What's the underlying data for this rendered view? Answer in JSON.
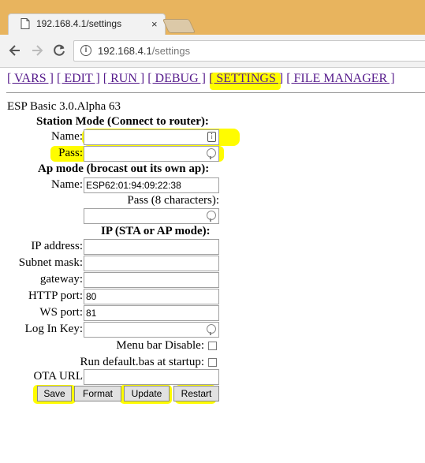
{
  "browser": {
    "tab_title": "192.168.4.1/settings",
    "tab_close": "×",
    "url_host": "192.168.4.1",
    "url_path": "/settings",
    "icons": [
      "page-icon",
      "close-icon",
      "back-arrow-icon",
      "forward-arrow-icon",
      "reload-icon",
      "info-icon"
    ]
  },
  "nav_menu": [
    {
      "label": "[ VARS ]"
    },
    {
      "label": "[ EDIT ]"
    },
    {
      "label": "[ RUN ]"
    },
    {
      "label": "[ DEBUG ]"
    },
    {
      "label": "[ SETTINGS ]"
    },
    {
      "label": "[ FILE MANAGER ]"
    }
  ],
  "version": "ESP Basic 3.0.Alpha 63",
  "station": {
    "heading": "Station Mode (Connect to router):",
    "name_label": "Name:",
    "name_value": "",
    "pass_label": "Pass:",
    "pass_value": ""
  },
  "ap": {
    "heading": "Ap mode (brocast out its own ap):",
    "name_label": "Name:",
    "name_value": "ESP62:01:94:09:22:38",
    "pass_label": "Pass (8 characters):",
    "pass_value": ""
  },
  "ip": {
    "heading": "IP (STA or AP mode):",
    "ip_label": "IP address:",
    "ip_value": "",
    "subnet_label": "Subnet mask:",
    "subnet_value": "",
    "gateway_label": "gateway:",
    "gateway_value": "",
    "http_port_label": "HTTP port:",
    "http_port_value": "80",
    "ws_port_label": "WS port:",
    "ws_port_value": "81",
    "login_key_label": "Log In Key:",
    "login_key_value": ""
  },
  "options": {
    "menu_bar_label": "Menu bar Disable:",
    "menu_bar_checked": false,
    "run_default_label": "Run default.bas at startup:",
    "run_default_checked": false,
    "ota_label": "OTA URL",
    "ota_value": ""
  },
  "buttons": {
    "save": "Save",
    "format": "Format",
    "update": "Update",
    "restart": "Restart"
  },
  "colors": {
    "link": "#551a8b",
    "highlight": "#fffc00",
    "tabbar": "#e8b45e"
  }
}
